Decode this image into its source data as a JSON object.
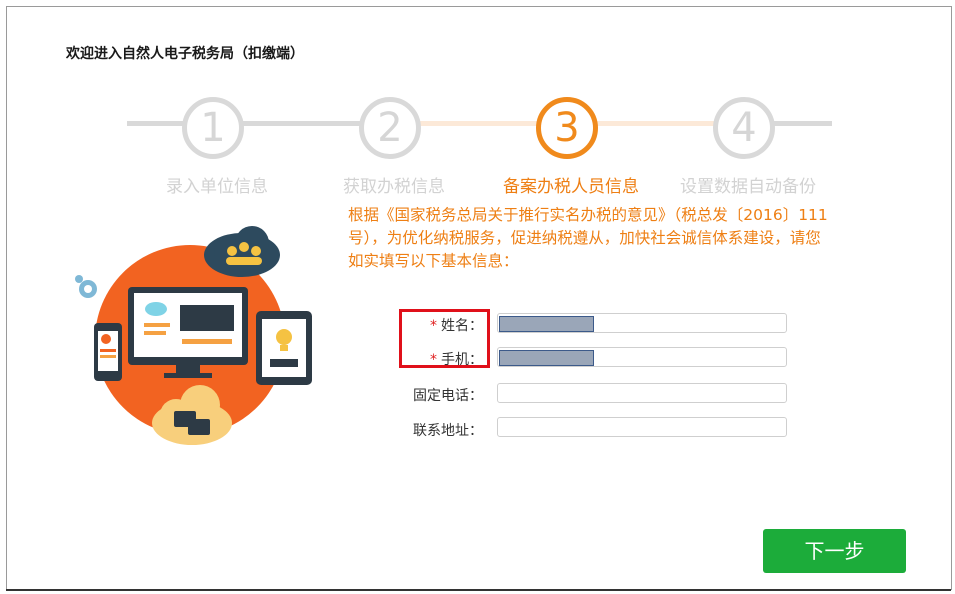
{
  "window": {
    "title": "欢迎进入自然人电子税务局（扣缴端）"
  },
  "steps": [
    {
      "number": "1",
      "label": "录入单位信息",
      "active": false
    },
    {
      "number": "2",
      "label": "获取办税信息",
      "active": false
    },
    {
      "number": "3",
      "label": "备案办税人员信息",
      "active": true
    },
    {
      "number": "4",
      "label": "设置数据自动备份",
      "active": false
    }
  ],
  "notice": "根据《国家税务总局关于推行实名办税的意见》（税总发〔2016〕111号），为优化纳税服务，促进纳税遵从，加快社会诚信体系建设，请您如实填写以下基本信息：",
  "form": {
    "name": {
      "label": "姓名：",
      "required_mark": "*",
      "value_state": "redacted"
    },
    "phone": {
      "label": "手机：",
      "required_mark": "*",
      "value_state": "redacted"
    },
    "landline": {
      "label": "固定电话：",
      "value": ""
    },
    "address": {
      "label": "联系地址：",
      "value": ""
    }
  },
  "buttons": {
    "next": "下一步"
  },
  "colors": {
    "accent": "#f08a1c",
    "inactive_step": "#d9d9d9",
    "next_button": "#1cac3a",
    "required": "#e02020",
    "highlight": "#e0101a"
  },
  "icons": [
    "gear-icon",
    "people-cloud-icon",
    "desktop-monitor-icon",
    "smartphone-icon",
    "tablet-icon",
    "lightbulb-icon",
    "chat-cloud-icon"
  ]
}
